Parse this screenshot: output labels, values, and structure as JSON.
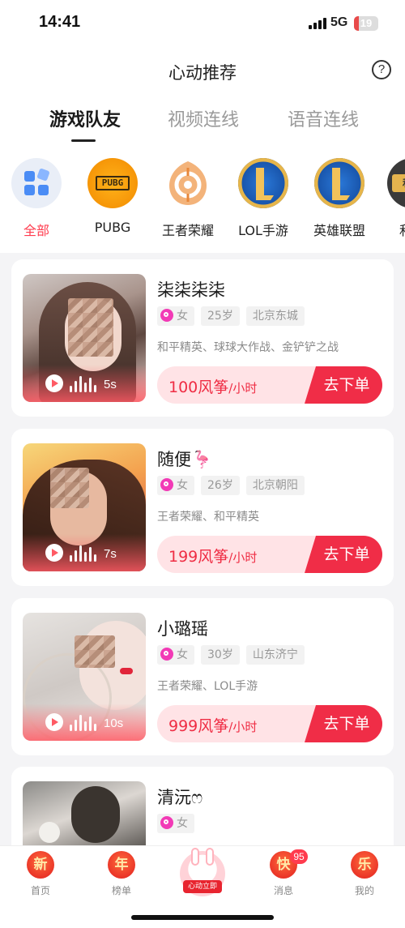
{
  "status_bar": {
    "time": "14:41",
    "network": "5G",
    "battery": "19",
    "battery_level": 0.19
  },
  "header": {
    "title": "心动推荐",
    "help_icon": "question-circle-icon",
    "help_label": "?"
  },
  "tabs": [
    {
      "label": "游戏队友",
      "active": true
    },
    {
      "label": "视频连线",
      "active": false
    },
    {
      "label": "语音连线",
      "active": false
    }
  ],
  "categories": [
    {
      "label": "全部",
      "icon": "grid-icon",
      "active": true
    },
    {
      "label": "PUBG",
      "icon": "pubg-icon",
      "active": false
    },
    {
      "label": "王者荣耀",
      "icon": "honor-of-kings-icon",
      "active": false
    },
    {
      "label": "LOL手游",
      "icon": "lol-mobile-icon",
      "active": false
    },
    {
      "label": "英雄联盟",
      "icon": "league-of-legends-icon",
      "active": false
    },
    {
      "label": "和平",
      "icon": "peace-elite-icon",
      "active": false
    }
  ],
  "pubg_logo_text": "PUBG",
  "peace_logo_text": "和平",
  "cards": [
    {
      "name": "柒柒柒柒",
      "gender": "女",
      "age": "25岁",
      "location": "北京东城",
      "games": "和平精英、球球大作战、金铲铲之战",
      "voice_duration": "5s",
      "price": "100风筝",
      "unit": "/小时",
      "order_label": "去下单"
    },
    {
      "name": "随便🦩",
      "gender": "女",
      "age": "26岁",
      "location": "北京朝阳",
      "games": "王者荣耀、和平精英",
      "voice_duration": "7s",
      "price": "199风筝",
      "unit": "/小时",
      "order_label": "去下单"
    },
    {
      "name": "小璐瑶",
      "gender": "女",
      "age": "30岁",
      "location": "山东济宁",
      "games": "王者荣耀、LOL手游",
      "voice_duration": "10s",
      "price": "999风筝",
      "unit": "/小时",
      "order_label": "去下单"
    },
    {
      "name": "清沅ෆ",
      "gender": "女"
    }
  ],
  "tabbar": [
    {
      "icon_text": "新",
      "label": "首页"
    },
    {
      "icon_text": "年",
      "label": "榜单"
    },
    {
      "center_label": "心动立即"
    },
    {
      "icon_text": "快",
      "label": "消息",
      "badge": "95"
    },
    {
      "icon_text": "乐",
      "label": "我的"
    }
  ]
}
